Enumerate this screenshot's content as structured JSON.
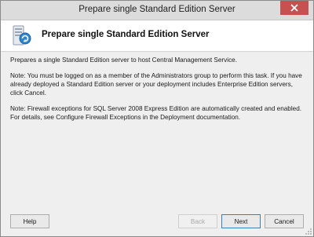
{
  "window": {
    "title": "Prepare single Standard Edition Server",
    "close_glyph": "✕"
  },
  "header": {
    "title": "Prepare single Standard Edition Server",
    "icon": "server-wizard-icon"
  },
  "content": {
    "paragraphs": [
      "Prepares a single Standard Edition server to host Central Management Service.",
      "Note: You must be logged on as a member of the Administrators group to perform this task. If you have already deployed a Standard Edition server or your deployment includes Enterprise Edition servers, click Cancel.",
      "Note: Firewall exceptions for SQL Server 2008 Express Edition are automatically created and enabled. For details, see Configure Firewall Exceptions in the Deployment documentation."
    ]
  },
  "buttons": {
    "help": "Help",
    "back": "Back",
    "next": "Next",
    "cancel": "Cancel"
  },
  "colors": {
    "close_button": "#c75050",
    "window_bg": "#efefef",
    "header_bg": "#ffffff"
  }
}
